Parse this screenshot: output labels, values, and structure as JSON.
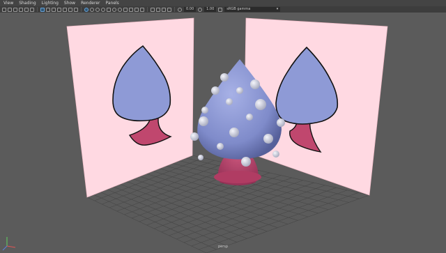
{
  "menubar": {
    "items": [
      "View",
      "Shading",
      "Lighting",
      "Show",
      "Renderer",
      "Panels"
    ]
  },
  "toolbar": {
    "exposure_value": "0.00",
    "gamma_value": "1.00",
    "color_space": "sRGB gamma",
    "color_space_arrow": "▾"
  },
  "viewport": {
    "camera_name": "persp",
    "colors": {
      "background": "#5b5b5b",
      "grid": "#474747",
      "image_plane": "#ffd9e2",
      "mushroom_cap": "#8e9ad6",
      "mushroom_stem": "#c0476e",
      "bubbles": "#dadce8"
    }
  }
}
